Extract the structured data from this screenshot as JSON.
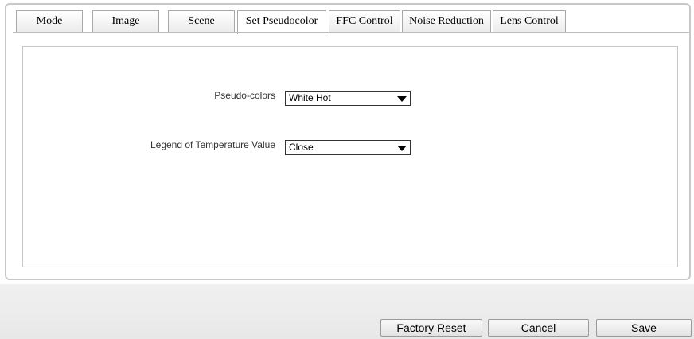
{
  "tabs": [
    {
      "label": "Mode",
      "active": false
    },
    {
      "label": "Image",
      "active": false
    },
    {
      "label": "Scene",
      "active": false
    },
    {
      "label": "Set Pseudocolor",
      "active": true
    },
    {
      "label": "FFC Control",
      "active": false
    },
    {
      "label": "Noise Reduction",
      "active": false
    },
    {
      "label": "Lens Control",
      "active": false
    }
  ],
  "form": {
    "pseudo_colors": {
      "label": "Pseudo-colors",
      "value": "White Hot"
    },
    "legend": {
      "label": "Legend of Temperature Value",
      "value": "Close"
    }
  },
  "buttons": {
    "factory_reset": "Factory Reset",
    "cancel": "Cancel",
    "save": "Save"
  }
}
